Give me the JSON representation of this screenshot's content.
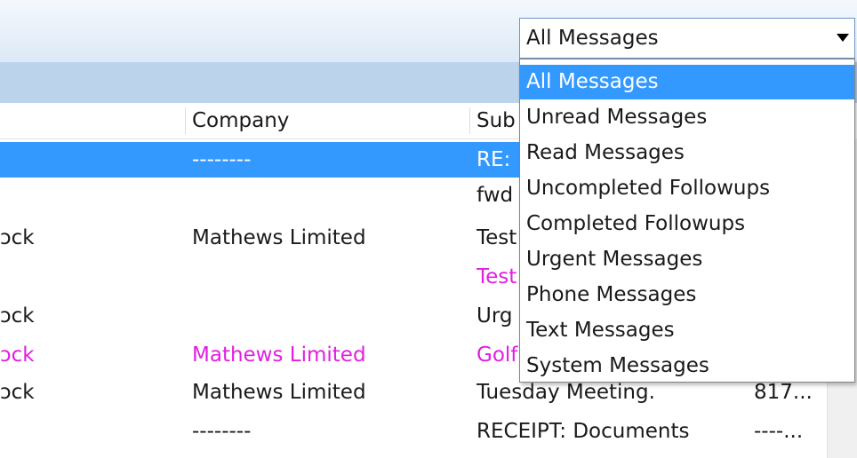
{
  "filter": {
    "selected": "All Messages",
    "options": [
      "All Messages",
      "Unread Messages",
      "Read Messages",
      "Uncompleted Followups",
      "Completed Followups",
      "Urgent Messages",
      "Phone Messages",
      "Text Messages",
      "System Messages"
    ]
  },
  "columns": {
    "company": "Company",
    "subject": "Sub"
  },
  "rows": [
    {
      "from": "",
      "company": "--------",
      "subject": "RE:",
      "code": "",
      "state": "selected"
    },
    {
      "from": "",
      "company": "",
      "subject": "fwd",
      "code": "",
      "state": "normal"
    },
    {
      "from": "ɔck",
      "company": "Mathews Limited",
      "subject": "Test",
      "code": "",
      "state": "normal"
    },
    {
      "from": "",
      "company": "",
      "subject": "Test",
      "code": "",
      "state": "magenta"
    },
    {
      "from": "ɔck",
      "company": "",
      "subject": "Urg",
      "code": "",
      "state": "normal"
    },
    {
      "from": "ɔck",
      "company": "Mathews Limited",
      "subject": "Golf",
      "code": "",
      "state": "magenta"
    },
    {
      "from": "ɔck",
      "company": "Mathews Limited",
      "subject": "Tuesday Meeting.",
      "code": "817...",
      "state": "normal"
    },
    {
      "from": "",
      "company": "--------",
      "subject": "RECEIPT: Documents f...",
      "code": "----...",
      "state": "normal"
    }
  ],
  "colors": {
    "selection": "#3399ff",
    "flagged": "#e01fe0"
  }
}
